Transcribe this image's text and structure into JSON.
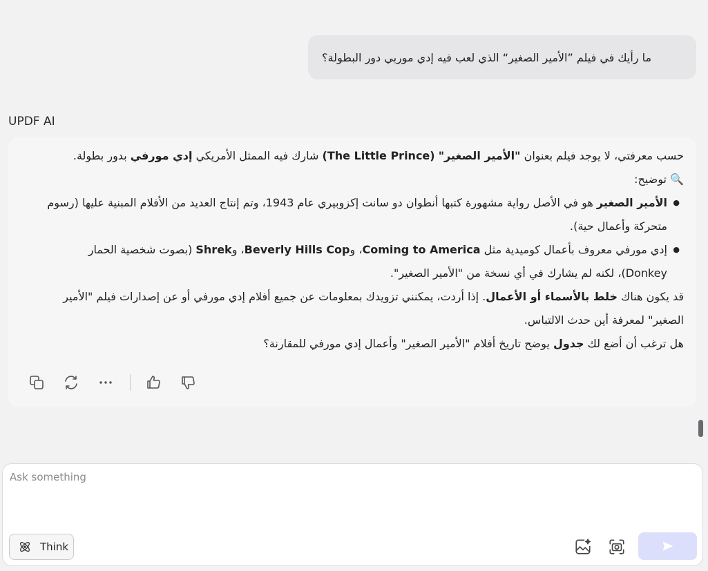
{
  "user_message": "ما رأيك في فيلم ”الأمير الصغير“ الذي لعب فيه إدي موربي دور البطولة؟",
  "ai_label": "UPDF AI",
  "answer": {
    "p1_a": "حسب معرفتي، لا يوجد فيلم بعنوان ",
    "p1_title_ar": "\"الأمير الصغير\"",
    "p1_title_en": "(The Little Prince)",
    "p1_b": " شارك فيه الممثل الأمريكي ",
    "p1_name": "إدي مورفي",
    "p1_c": " بدور بطولة.",
    "explain_icon": "🔍",
    "explain_label": "توضيح:",
    "b1_bold": "الأمير الصغير",
    "b1_text": " هو في الأصل رواية مشهورة كتبها أنطوان دو سانت إكزوبيري عام 1943، وتم إنتاج العديد من الأفلام المبنية عليها (رسوم متحركة وأعمال حية).",
    "b2_a": "إدي مورفي معروف بأعمال كوميدية مثل ",
    "b2_m1": "Coming to America",
    "b2_b": "، و",
    "b2_m2": "Beverly Hills Cop",
    "b2_c": "، و",
    "b2_m3": "Shrek",
    "b2_d": " (بصوت شخصية الحمار Donkey)، لكنه لم يشارك في أي نسخة من \"الأمير الصغير\".",
    "p3_a": "قد يكون هناك ",
    "p3_bold": "خلط بالأسماء أو الأعمال",
    "p3_b": ". إذا أردت، يمكنني تزويدك بمعلومات عن جميع أفلام إدي مورفي أو عن إصدارات فيلم \"الأمير الصغير\" لمعرفة أين حدث الالتباس.",
    "p4_a": "هل ترغب أن أضع لك ",
    "p4_bold": "جدول",
    "p4_b": " يوضح تاريخ أفلام \"الأمير الصغير\" وأعمال إدي مورفي للمقارنة؟"
  },
  "actions": {
    "copy_icon": "copy-icon",
    "regenerate_icon": "regenerate-icon",
    "more_icon": "more-icon",
    "like_icon": "thumbs-up-icon",
    "dislike_icon": "thumbs-down-icon"
  },
  "composer": {
    "placeholder": "Ask something",
    "think_label": "Think"
  },
  "colors": {
    "background": "#f2f2f3",
    "user_bubble": "#e6e6e8",
    "send_button": "#dcdffb"
  }
}
